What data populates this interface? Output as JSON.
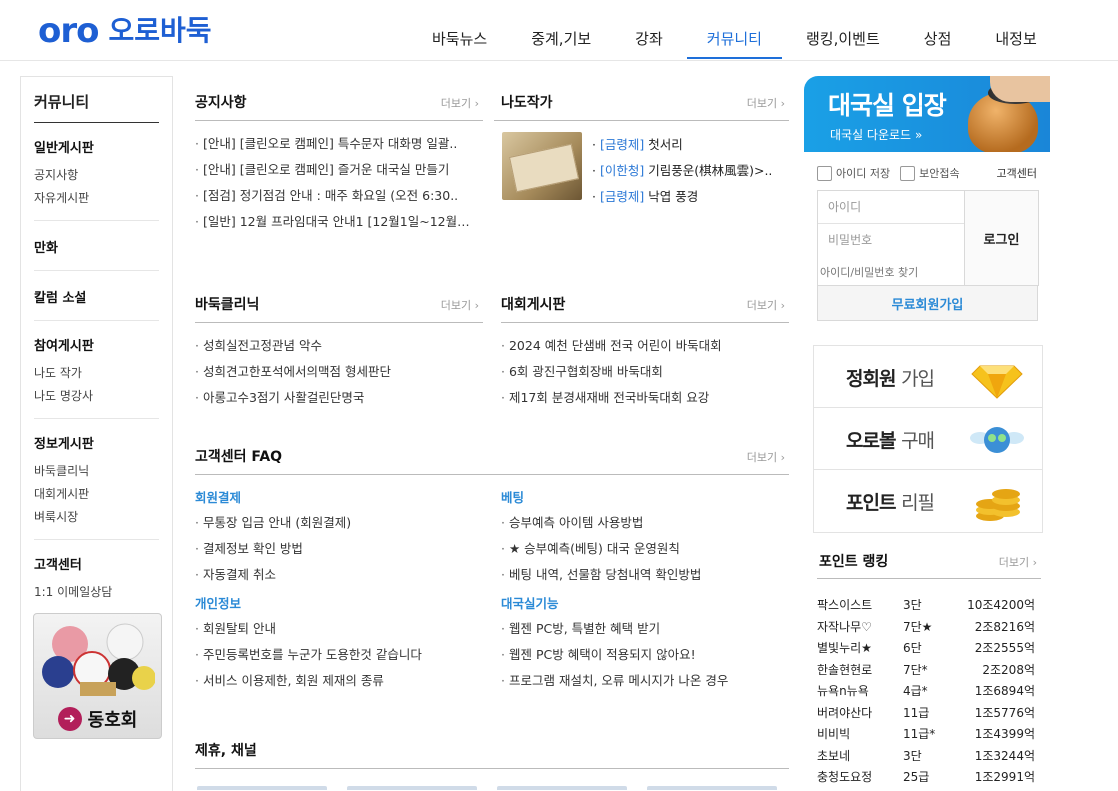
{
  "header": {
    "logo_mark": "oro",
    "logo_text": "오로바둑",
    "nav": [
      {
        "label": "바둑뉴스",
        "active": false
      },
      {
        "label": "중계,기보",
        "active": false
      },
      {
        "label": "강좌",
        "active": false
      },
      {
        "label": "커뮤니티",
        "active": true
      },
      {
        "label": "랭킹,이벤트",
        "active": false
      },
      {
        "label": "상점",
        "active": false
      },
      {
        "label": "내정보",
        "active": false
      }
    ]
  },
  "sidebar": {
    "title": "커뮤니티",
    "groups": [
      {
        "title": "일반게시판",
        "items": [
          "공지사항",
          "자유게시판"
        ]
      },
      {
        "title": "만화",
        "items": []
      },
      {
        "title": "칼럼 소설",
        "items": []
      },
      {
        "title": "참여게시판",
        "items": [
          "나도 작가",
          "나도 명강사"
        ]
      },
      {
        "title": "정보게시판",
        "items": [
          "바둑클리닉",
          "대회게시판",
          "벼룩시장"
        ]
      },
      {
        "title": "고객센터",
        "items": [
          "1:1 이메일상담"
        ]
      }
    ],
    "club_label": "동호회"
  },
  "more_label": "더보기",
  "notice": {
    "title": "공지사항",
    "items": [
      "[안내] [클린오로 캠페인] 특수문자 대화명 일괄..",
      "[안내] [클린오로 캠페인] 즐거운 대국실 만들기",
      "[점검] 정기점검 안내 : 매주 화요일 (오전 6:30..",
      "[일반] 12월 프라임대국 안내1 [12월1일~12월…"
    ]
  },
  "nado": {
    "title": "나도작가",
    "items": [
      {
        "tag": "[금령제]",
        "text": "첫서리"
      },
      {
        "tag": "[이한청]",
        "text": "기림풍운(棋林風雲)>.."
      },
      {
        "tag": "[금령제]",
        "text": "낙엽 풍경"
      }
    ]
  },
  "clinic": {
    "title": "바둑클리닉",
    "items": [
      "성희실전고정관념 악수",
      "성희견고한포석에서의맥점 형세판단",
      "아롱고수3점기 사활걸린단명국"
    ]
  },
  "contest": {
    "title": "대회게시판",
    "items": [
      "2024 예천 단샘배 전국 어린이 바둑대회",
      "6회 광진구협회장배 바둑대회",
      "제17회 분경새재배 전국바둑대회 요강"
    ]
  },
  "faq": {
    "title": "고객센터 FAQ",
    "left": [
      {
        "subtitle": "회원결제",
        "items": [
          "무통장 입금 안내 (회원결제)",
          "결제정보 확인 방법",
          "자동결제 취소"
        ]
      },
      {
        "subtitle": "개인정보",
        "items": [
          "회원탈퇴 안내",
          "주민등록번호를 누군가 도용한것 같습니다",
          "서비스 이용제한, 회원 제재의 종류"
        ]
      }
    ],
    "right": [
      {
        "subtitle": "베팅",
        "items": [
          "승부예측 아이템 사용방법",
          "★ 승부예측(베팅) 대국 운영원칙",
          "베팅 내역, 선물함 당첨내역 확인방법"
        ]
      },
      {
        "subtitle": "대국실기능",
        "items": [
          "웹젠 PC방, 특별한 혜택 받기",
          "웹젠 PC방 혜택이 적용되지 않아요!",
          "프로그램 재설치, 오류 메시지가 나온 경우"
        ]
      }
    ]
  },
  "partners": {
    "title": "제휴, 채널"
  },
  "login": {
    "banner_title": "대국실 입장",
    "banner_sub": "대국실 다운로드",
    "save_id": "아이디 저장",
    "secure": "보안접속",
    "customer_center": "고객센터",
    "id_placeholder": "아이디",
    "pw_placeholder": "비밀번호",
    "login_button": "로그인",
    "find": "아이디/비밀번호 찾기",
    "signup": "무료회원가입"
  },
  "promos": [
    {
      "bold": "정회원",
      "light": "가입",
      "icon": "diamond-icon"
    },
    {
      "bold": "오로볼",
      "light": "구매",
      "icon": "winged-ball-icon"
    },
    {
      "bold": "포인트",
      "light": "리필",
      "icon": "coins-icon"
    }
  ],
  "ranking": {
    "title": "포인트 랭킹",
    "rows": [
      {
        "name": "팍스이스트",
        "level": "3단",
        "point": "10조4200억"
      },
      {
        "name": "자작나무♡",
        "level": "7단★",
        "point": "2조8216억"
      },
      {
        "name": "별빛누리★",
        "level": "6단",
        "point": "2조2555억"
      },
      {
        "name": "한솔현현로",
        "level": "7단*",
        "point": "2조208억"
      },
      {
        "name": "뉴욕n뉴욕",
        "level": "4급*",
        "point": "1조6894억"
      },
      {
        "name": "버려야산다",
        "level": "11급",
        "point": "1조5776억"
      },
      {
        "name": "비비빅",
        "level": "11급*",
        "point": "1조4399억"
      },
      {
        "name": "초보네",
        "level": "3단",
        "point": "1조3244억"
      },
      {
        "name": "충청도요정",
        "level": "25급",
        "point": "1조2991억"
      }
    ]
  }
}
